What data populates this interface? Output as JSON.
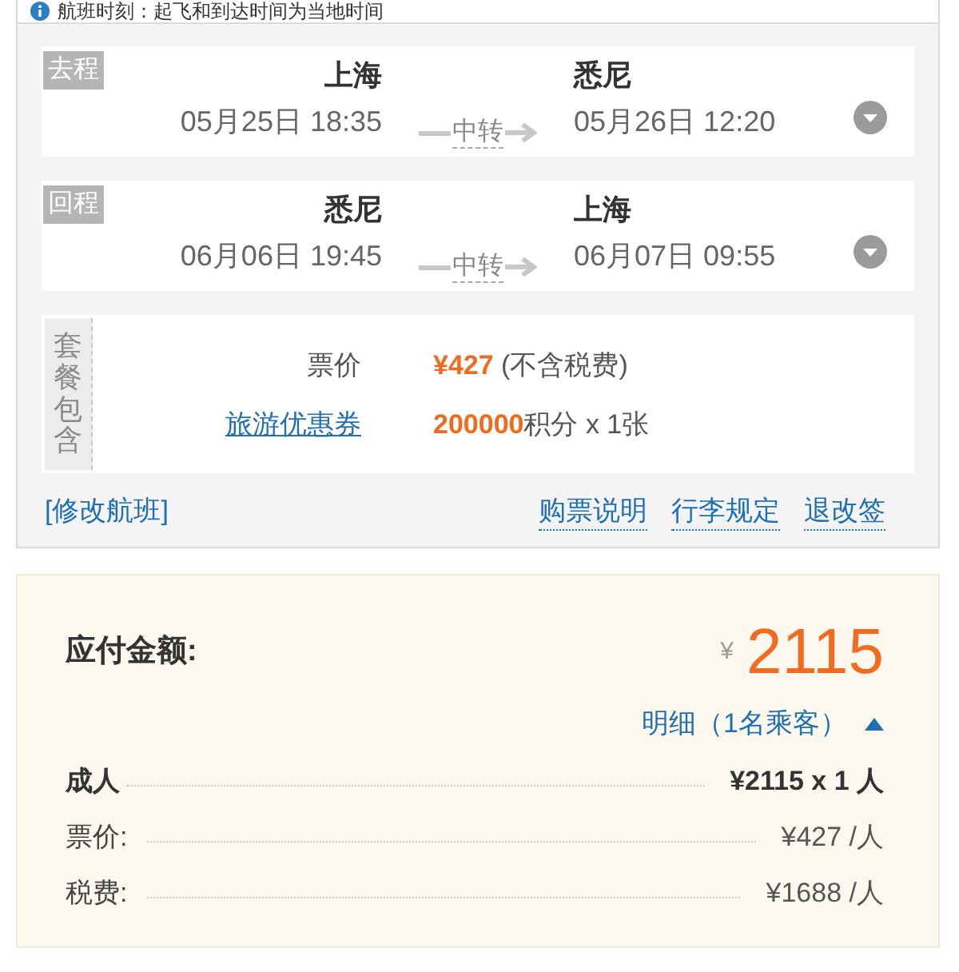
{
  "notice": {
    "text": "航班时刻：起飞和到达时间为当地时间"
  },
  "flights": [
    {
      "label": "去程",
      "departure": {
        "city": "上海",
        "time": "05月25日 18:35"
      },
      "transfer": "中转",
      "arrival": {
        "city": "悉尼",
        "time": "05月26日 12:20"
      }
    },
    {
      "label": "回程",
      "departure": {
        "city": "悉尼",
        "time": "06月06日 19:45"
      },
      "transfer": "中转",
      "arrival": {
        "city": "上海",
        "time": "06月07日 09:55"
      }
    }
  ],
  "package": {
    "label": "套餐包含",
    "items": [
      {
        "kind": "text",
        "label": "票价",
        "value": "**¥427** (不含税费)"
      },
      {
        "kind": "link",
        "label": "旅游优惠券",
        "value": "**200000**积分 x 1张"
      }
    ]
  },
  "actions": {
    "modify": "[修改航班]",
    "links": [
      "购票说明",
      "行李规定",
      "退改签"
    ]
  },
  "payment": {
    "label": "应付金额:",
    "currency": "¥",
    "amount": "2115",
    "details": {
      "label": "明细（1名乘客）",
      "expanded": true
    },
    "rows": [
      {
        "kind": "total",
        "label": "成人",
        "value": "¥2115 x 1 人"
      },
      {
        "kind": "item",
        "label": "票价:",
        "value": "¥427 /人"
      },
      {
        "kind": "item",
        "label": "税费:",
        "value": "¥1688 /人"
      }
    ]
  }
}
